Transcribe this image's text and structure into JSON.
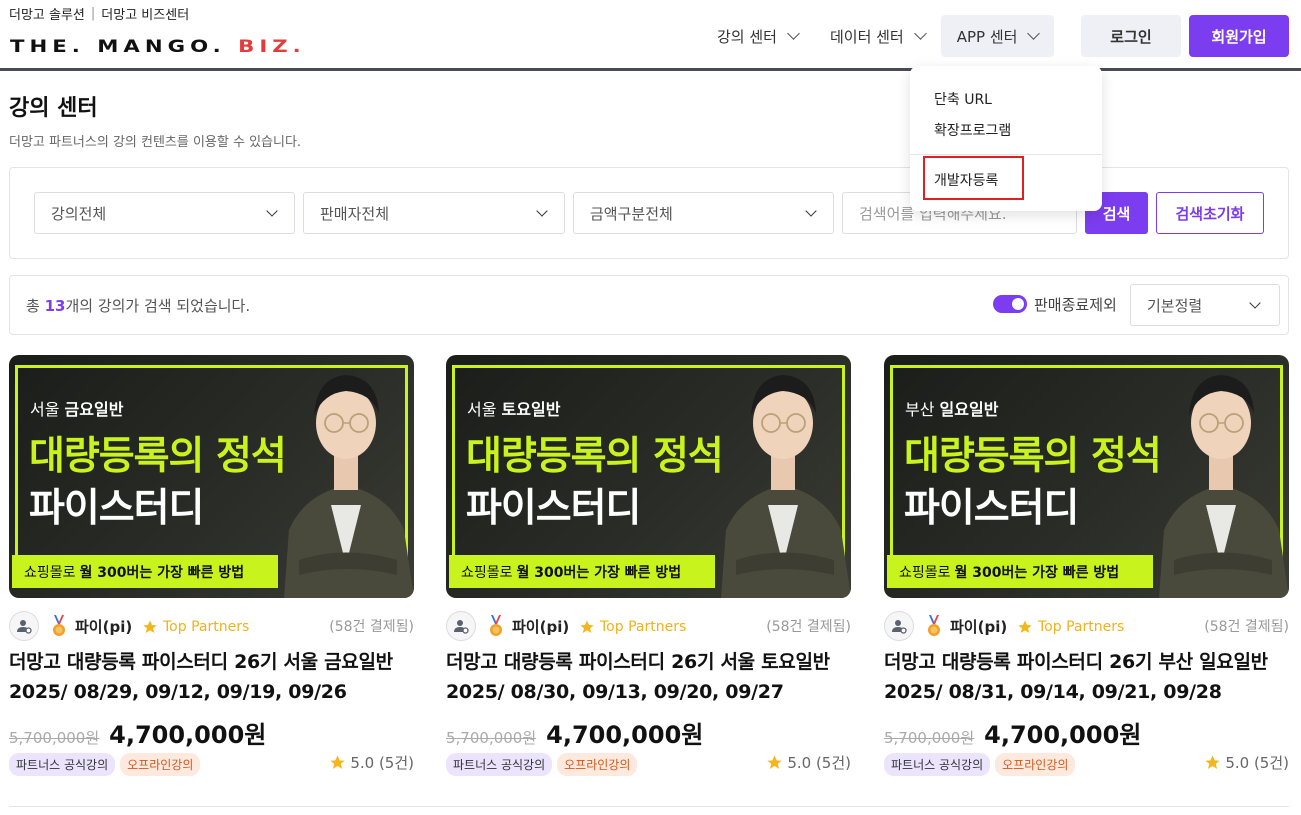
{
  "header": {
    "top_links": [
      "더망고 솔루션",
      "더망고 비즈센터"
    ],
    "top_links_sep": "|",
    "logo_main": "THE. MANGO. ",
    "logo_biz": "BIZ.",
    "nav": [
      {
        "label": "강의 센터"
      },
      {
        "label": "데이터 센터"
      },
      {
        "label": "APP 센터"
      }
    ],
    "login_label": "로그인",
    "signup_label": "회원가입"
  },
  "app_dropdown": {
    "items": [
      "단축 URL",
      "확장프로그램",
      "개발자등록"
    ]
  },
  "page": {
    "title": "강의 센터",
    "description": "더망고 파트너스의 강의 컨텐츠를 이용할 수 있습니다."
  },
  "filters": {
    "category": "강의전체",
    "seller": "판매자전체",
    "price_type": "금액구분전체",
    "search_placeholder": "검색어를 입력해주세요.",
    "search_label": "검색",
    "reset_label": "검색초기화"
  },
  "results": {
    "prefix": "총 ",
    "count": "13",
    "suffix": "개의 강의가 검색 되었습니다.",
    "toggle_label": "판매종료제외",
    "sort": "기본정렬"
  },
  "colors": {
    "accent": "#7c3cf0",
    "thumb_lime": "#c9f31d",
    "partner_gold": "#f0b21c"
  },
  "cards": [
    {
      "thumb_region": "서울",
      "thumb_day": "금요일반",
      "thumb_title1": "대량등록의 정석",
      "thumb_title2": "파이스터디",
      "thumb_banner_a": "쇼핑몰로",
      "thumb_banner_b": "월 300버는 가장 빠른 방법",
      "seller": "파이(pi)",
      "partner": "Top Partners",
      "sales": "(58건 결제됨)",
      "title_line1": "더망고 대량등록 파이스터디 26기 서울 금요일반",
      "title_line2": "2025/ 08/29, 09/12, 09/19, 09/26",
      "price_old": "5,700,000원",
      "price_new": "4,700,000원",
      "tag1": "파트너스 공식강의",
      "tag2": "오프라인강의",
      "rating": "5.0 (5건)"
    },
    {
      "thumb_region": "서울",
      "thumb_day": "토요일반",
      "thumb_title1": "대량등록의 정석",
      "thumb_title2": "파이스터디",
      "thumb_banner_a": "쇼핑몰로",
      "thumb_banner_b": "월 300버는 가장 빠른 방법",
      "seller": "파이(pi)",
      "partner": "Top Partners",
      "sales": "(58건 결제됨)",
      "title_line1": "더망고 대량등록 파이스터디 26기 서울 토요일반",
      "title_line2": "2025/ 08/30, 09/13, 09/20, 09/27",
      "price_old": "5,700,000원",
      "price_new": "4,700,000원",
      "tag1": "파트너스 공식강의",
      "tag2": "오프라인강의",
      "rating": "5.0 (5건)"
    },
    {
      "thumb_region": "부산",
      "thumb_day": "일요일반",
      "thumb_title1": "대량등록의 정석",
      "thumb_title2": "파이스터디",
      "thumb_banner_a": "쇼핑몰로",
      "thumb_banner_b": "월 300버는 가장 빠른 방법",
      "seller": "파이(pi)",
      "partner": "Top Partners",
      "sales": "(58건 결제됨)",
      "title_line1": "더망고 대량등록 파이스터디 26기 부산 일요일반",
      "title_line2": "2025/ 08/31, 09/14, 09/21, 09/28",
      "price_old": "5,700,000원",
      "price_new": "4,700,000원",
      "tag1": "파트너스 공식강의",
      "tag2": "오프라인강의",
      "rating": "5.0 (5건)"
    }
  ]
}
